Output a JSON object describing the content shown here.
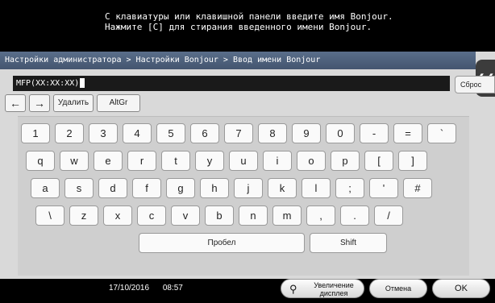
{
  "message": {
    "line1": "С клавиатуры или клавишной панели введите имя Bonjour.",
    "line2": "Нажмите [C] для стирания введенного имени Bonjour."
  },
  "breadcrumb": "Настройки администратора > Настройки Bonjour > Ввод имени Bonjour",
  "side_tab_icon": "collapse-left-icon",
  "input": {
    "value": "MFP(XX:XX:XX)"
  },
  "reset_label": "Сброс",
  "function_keys": {
    "left_arrow": "←",
    "right_arrow": "→",
    "delete": "Удалить",
    "altgr": "AltGr"
  },
  "keyboard": {
    "row1": [
      "1",
      "2",
      "3",
      "4",
      "5",
      "6",
      "7",
      "8",
      "9",
      "0",
      "-",
      "=",
      "`"
    ],
    "row2": [
      "q",
      "w",
      "e",
      "r",
      "t",
      "y",
      "u",
      "i",
      "o",
      "p",
      "[",
      "]"
    ],
    "row3": [
      "a",
      "s",
      "d",
      "f",
      "g",
      "h",
      "j",
      "k",
      "l",
      ";",
      "'",
      "#"
    ],
    "row4": [
      "\\",
      "z",
      "x",
      "c",
      "v",
      "b",
      "n",
      "m",
      ",",
      ".",
      "/"
    ],
    "space_label": "Пробел",
    "shift_label": "Shift"
  },
  "status": {
    "date": "17/10/2016",
    "time": "08:57"
  },
  "bottom_buttons": {
    "zoom_label_1": "Увеличение",
    "zoom_label_2": "дисплея",
    "zoom_icon": "magnifier-icon",
    "cancel_label": "Отмена",
    "ok_label": "OK"
  }
}
